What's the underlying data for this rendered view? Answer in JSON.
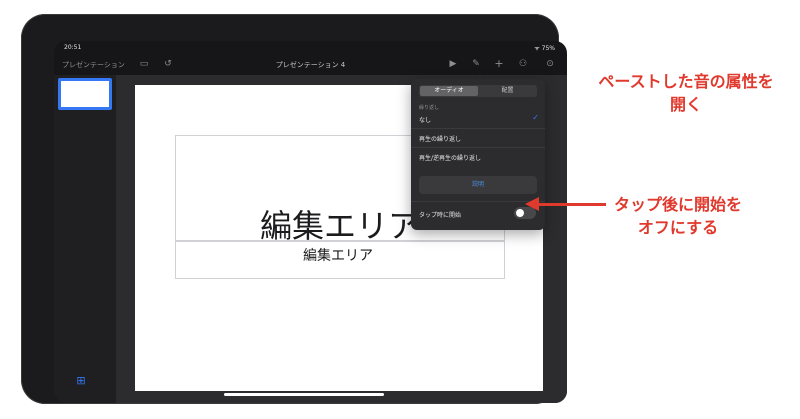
{
  "status_bar": {
    "time": "20:51",
    "right": "ᯤ 75%"
  },
  "toolbar": {
    "presentations_label": "プレゼンテーション",
    "doc_title": "プレゼンテーション 4",
    "play_icon": "play-icon",
    "format_icon": "paintbrush-icon",
    "add_icon": "plus-icon",
    "collab_icon": "collaborate-icon",
    "more_icon": "more-icon"
  },
  "slide": {
    "title_text": "編集エリア",
    "body_text": "編集エリア"
  },
  "popover": {
    "tabs": [
      "オーディオ",
      "配置"
    ],
    "repeat_label": "繰り返し",
    "repeat_options": [
      {
        "label": "なし",
        "selected": true
      },
      {
        "label": "再生の繰り返し",
        "selected": false
      },
      {
        "label": "再生/逆再生の繰り返し",
        "selected": false
      }
    ],
    "description_button": "説明",
    "tap_to_start_label": "タップ時に開始",
    "tap_to_start_on": false
  },
  "annotations": {
    "top_line1": "ペーストした音の属性を",
    "top_line2": "開く",
    "bottom_line1": "タップ後に開始を",
    "bottom_line2": "オフにする"
  },
  "colors": {
    "accent": "#3478f6",
    "annotation": "#e0392d"
  }
}
